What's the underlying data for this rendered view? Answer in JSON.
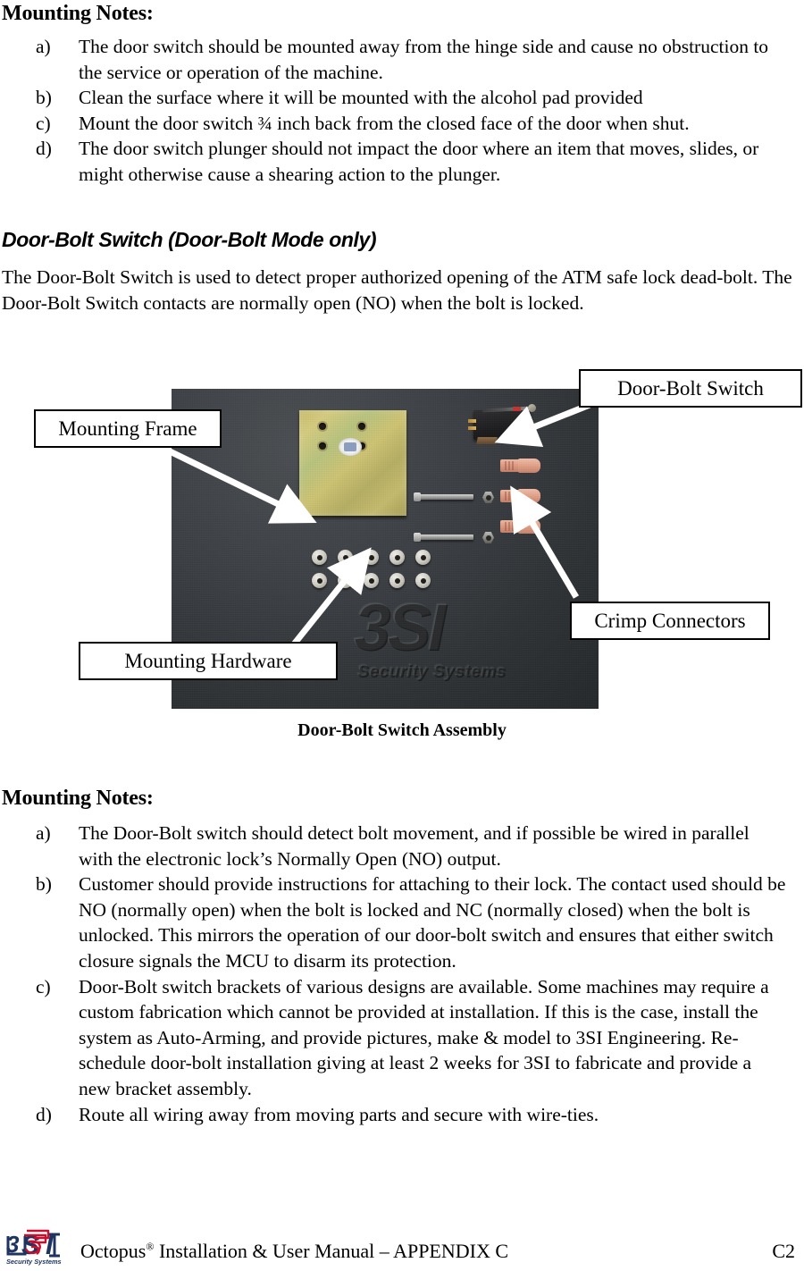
{
  "top_section": {
    "heading": "Mounting Notes:",
    "items": [
      {
        "marker": "a)",
        "text": "The door switch should be mounted away from the hinge side and cause no obstruction to the service or operation of the machine."
      },
      {
        "marker": "b)",
        "text": "Clean the surface where it will be mounted with the alcohol pad provided"
      },
      {
        "marker": "c)",
        "text": "Mount the door switch ¾ inch back from the closed face of the door when shut."
      },
      {
        "marker": "d)",
        "text": "The door switch plunger should not impact the door where an item that moves, slides, or might otherwise cause a shearing action to the plunger."
      }
    ]
  },
  "door_bolt_section": {
    "title": "Door-Bolt Switch (Door-Bolt Mode only)",
    "paragraph": "The Door-Bolt Switch is used to detect proper authorized opening of the ATM safe lock dead-bolt. The Door-Bolt Switch contacts are normally open (NO) when the bolt is locked."
  },
  "figure": {
    "caption": "Door-Bolt Switch Assembly",
    "callouts": [
      {
        "id": "door-bolt-switch",
        "label": "Door-Bolt Switch"
      },
      {
        "id": "mounting-frame",
        "label": "Mounting Frame"
      },
      {
        "id": "crimp-connectors",
        "label": "Crimp Connectors"
      },
      {
        "id": "mounting-hardware",
        "label": "Mounting Hardware"
      }
    ],
    "photo_logo": {
      "brand": "3SI",
      "tagline": "Security Systems"
    }
  },
  "bottom_section": {
    "heading": "Mounting Notes:",
    "items": [
      {
        "marker": "a)",
        "text": "The Door-Bolt switch should detect bolt movement, and if possible be wired in parallel with the electronic lock’s Normally Open (NO) output."
      },
      {
        "marker": "b)",
        "text": "Customer should provide instructions for attaching to their lock. The contact used should be NO (normally open) when the bolt is locked and NC (normally closed) when the bolt is unlocked. This mirrors the operation of our door-bolt switch and ensures that either switch closure signals the MCU to disarm its protection."
      },
      {
        "marker": "c)",
        "text": "Door-Bolt switch brackets of various designs are available. Some machines may require a custom fabrication which cannot be provided at installation. If this is the case, install the system as Auto-Arming, and provide pictures, make & model to 3SI Engineering. Re-schedule door-bolt installation giving at least 2 weeks for 3SI to fabricate and provide a new bracket assembly."
      },
      {
        "marker": "d)",
        "text": "Route all wiring away from moving parts and secure with wire-ties."
      }
    ]
  },
  "footer": {
    "logo": {
      "brand": "3SI",
      "tagline": "Security Systems",
      "brand_color": "#1d3461",
      "accent_color": "#c8102e"
    },
    "manual_name": "Octopus",
    "registered_mark": "®",
    "manual_rest": " Installation & User Manual – APPENDIX C",
    "page_number": "C2"
  }
}
